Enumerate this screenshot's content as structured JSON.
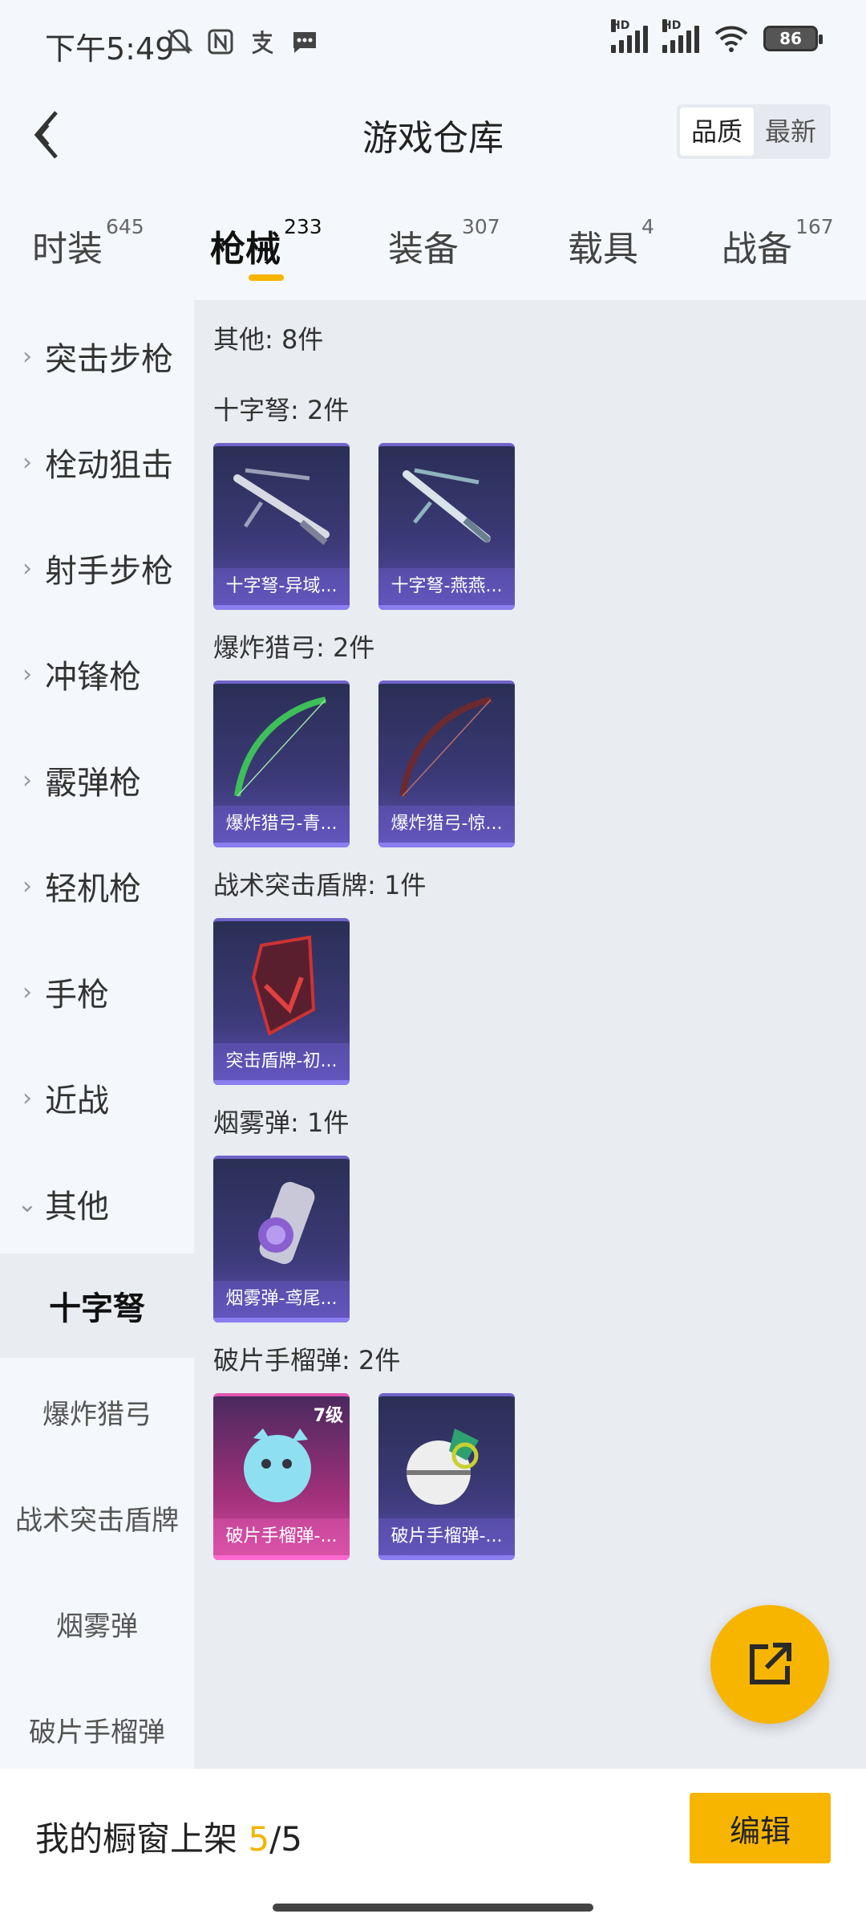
{
  "status_bar": {
    "time": "下午5:49",
    "icons_left": [
      "bell-off-icon",
      "nfc-icon",
      "alipay-icon",
      "message-icon"
    ],
    "hd1": "HD",
    "hd2": "HD",
    "battery": "86"
  },
  "header": {
    "title": "游戏仓库",
    "sort_options": [
      "品质",
      "最新"
    ],
    "sort_selected": "品质"
  },
  "tabs": [
    {
      "label": "时装",
      "count": "645"
    },
    {
      "label": "枪械",
      "count": "233",
      "active": true
    },
    {
      "label": "装备",
      "count": "307"
    },
    {
      "label": "载具",
      "count": "4"
    },
    {
      "label": "战备",
      "count": "167"
    }
  ],
  "sidebar": {
    "categories": [
      "突击步枪",
      "栓动狙击",
      "射手步枪",
      "冲锋枪",
      "霰弹枪",
      "轻机枪",
      "手枪",
      "近战",
      "其他"
    ],
    "subcategories": [
      "十字弩",
      "爆炸猎弓",
      "战术突击盾牌",
      "烟雾弹",
      "破片手榴弹"
    ],
    "active_sub": "十字弩"
  },
  "content": {
    "summary": "其他: 8件",
    "groups": [
      {
        "title": "十字弩: 2件",
        "items": [
          {
            "name": "十字弩-异域..."
          },
          {
            "name": "十字弩-燕燕..."
          }
        ]
      },
      {
        "title": "爆炸猎弓: 2件",
        "items": [
          {
            "name": "爆炸猎弓-青..."
          },
          {
            "name": "爆炸猎弓-惊..."
          }
        ]
      },
      {
        "title": "战术突击盾牌: 1件",
        "items": [
          {
            "name": "突击盾牌-初..."
          }
        ]
      },
      {
        "title": "烟雾弹: 1件",
        "items": [
          {
            "name": "烟雾弹-鸢尾..."
          }
        ]
      },
      {
        "title": "破片手榴弹: 2件",
        "items": [
          {
            "name": "破片手榴弹-...",
            "level": "7级"
          },
          {
            "name": "破片手榴弹-..."
          }
        ]
      }
    ]
  },
  "bottom": {
    "showcase_label": "我的橱窗上架 ",
    "showcase_current": "5",
    "showcase_total": "/5",
    "edit_label": "编辑"
  },
  "colors": {
    "accent": "#f7b500",
    "card_purple": "#3c3a78",
    "card_pink": "#d24aa0"
  }
}
